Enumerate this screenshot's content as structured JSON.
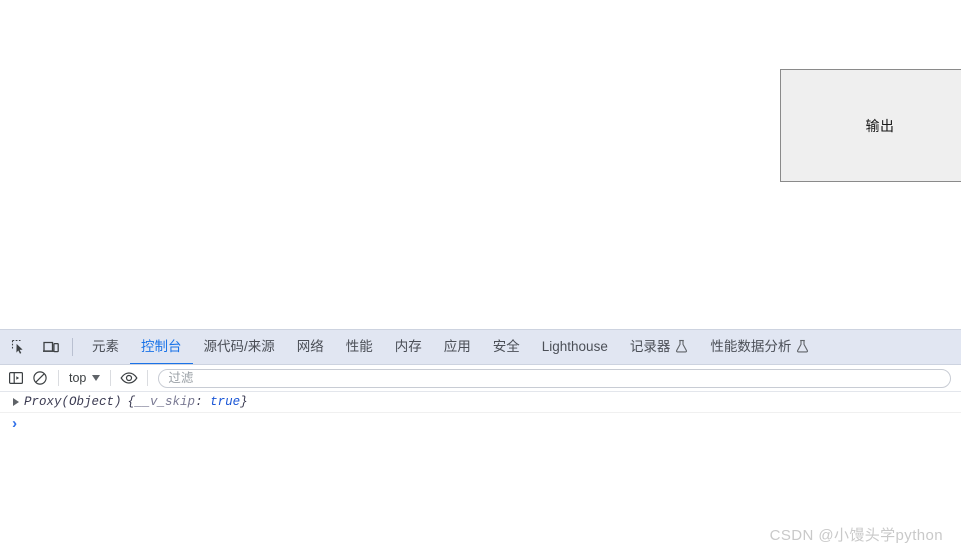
{
  "page": {
    "output_box": {
      "label": "输出",
      "bg_color": "#efefef",
      "border_color": "#8a8a8a"
    }
  },
  "devtools": {
    "accent_color": "#1a73e8",
    "tabstrip_bg": "#e1e6f2",
    "left_icons": [
      {
        "name": "inspect-element-icon",
        "title": "检查"
      },
      {
        "name": "device-toolbar-icon",
        "title": "切换设备工具栏"
      }
    ],
    "tabs": [
      {
        "label": "元素",
        "active": false,
        "flask": false
      },
      {
        "label": "控制台",
        "active": true,
        "flask": false
      },
      {
        "label": "源代码/来源",
        "active": false,
        "flask": false
      },
      {
        "label": "网络",
        "active": false,
        "flask": false
      },
      {
        "label": "性能",
        "active": false,
        "flask": false
      },
      {
        "label": "内存",
        "active": false,
        "flask": false
      },
      {
        "label": "应用",
        "active": false,
        "flask": false
      },
      {
        "label": "安全",
        "active": false,
        "flask": false
      },
      {
        "label": "Lighthouse",
        "active": false,
        "flask": false
      },
      {
        "label": "记录器",
        "active": false,
        "flask": true
      },
      {
        "label": "性能数据分析",
        "active": false,
        "flask": true
      }
    ],
    "console_toolbar": {
      "sidebar_toggle": "console-sidebar-icon",
      "clear_console": "clear-console-icon",
      "context_value": "top",
      "eye_icon": "live-expression-eye-icon",
      "filter_placeholder": "过滤",
      "filter_value": ""
    },
    "console_messages": [
      {
        "expandable": true,
        "object_name": "Proxy(Object)",
        "open_brace": "{",
        "prop_key": "__v_skip",
        "colon": ": ",
        "prop_value": "true",
        "close_brace": "}"
      }
    ],
    "prompt": {
      "caret": "›"
    }
  },
  "watermark": {
    "text": "CSDN @小馒头学python"
  }
}
